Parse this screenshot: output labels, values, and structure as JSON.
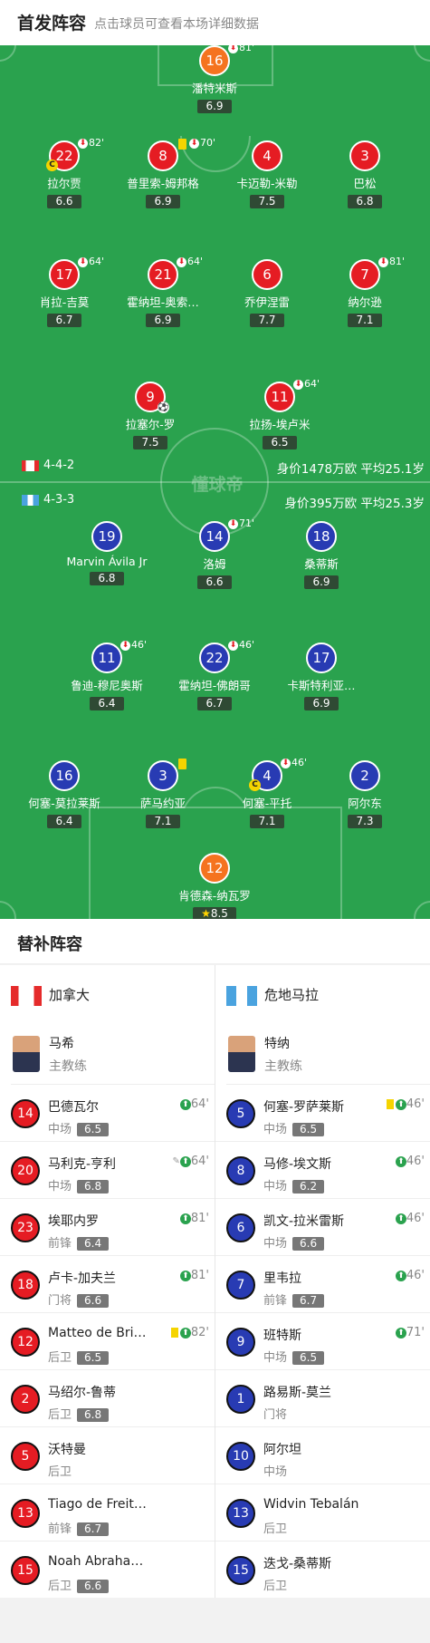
{
  "header": {
    "title": "首发阵容",
    "subtitle": "点击球员可查看本场详细数据"
  },
  "watermark": "懂球帝",
  "home": {
    "formation": "4-4-2",
    "info": "身价1478万欧  平均25.1岁",
    "players": [
      {
        "num": "16",
        "name": "潘特米斯",
        "rating": "6.9",
        "sub": "81'"
      },
      {
        "num": "22",
        "name": "拉尔贾",
        "rating": "6.6",
        "sub": "82'",
        "captain": "C"
      },
      {
        "num": "8",
        "name": "普里索-姆邦格",
        "rating": "6.9",
        "sub": "70'",
        "yellow": true
      },
      {
        "num": "4",
        "name": "卡迈勒-米勒",
        "rating": "7.5"
      },
      {
        "num": "3",
        "name": "巴松",
        "rating": "6.8"
      },
      {
        "num": "17",
        "name": "肖拉-吉莫",
        "rating": "6.7",
        "sub": "64'"
      },
      {
        "num": "21",
        "name": "霍纳坦-奥索…",
        "rating": "6.9",
        "sub": "64'"
      },
      {
        "num": "6",
        "name": "乔伊涅雷",
        "rating": "7.7"
      },
      {
        "num": "7",
        "name": "纳尔逊",
        "rating": "7.1",
        "sub": "81'"
      },
      {
        "num": "9",
        "name": "拉塞尔-罗",
        "rating": "7.5",
        "goal": true
      },
      {
        "num": "11",
        "name": "拉扬-埃卢米",
        "rating": "6.5",
        "sub": "64'"
      }
    ]
  },
  "away": {
    "formation": "4-3-3",
    "info": "身价395万欧    平均25.3岁",
    "players": [
      {
        "num": "19",
        "name": "Marvin Ávila Jr",
        "rating": "6.8"
      },
      {
        "num": "14",
        "name": "洛姆",
        "rating": "6.6",
        "sub": "71'"
      },
      {
        "num": "18",
        "name": "桑蒂斯",
        "rating": "6.9"
      },
      {
        "num": "11",
        "name": "鲁迪-穆尼奥斯",
        "rating": "6.4",
        "sub": "46'"
      },
      {
        "num": "22",
        "name": "霍纳坦-佛朗哥",
        "rating": "6.7",
        "sub": "46'"
      },
      {
        "num": "17",
        "name": "卡斯特利亚…",
        "rating": "6.9"
      },
      {
        "num": "16",
        "name": "何塞-莫拉莱斯",
        "rating": "6.4"
      },
      {
        "num": "3",
        "name": "萨马约亚",
        "rating": "7.1",
        "yellow": true
      },
      {
        "num": "4",
        "name": "何塞-平托",
        "rating": "7.1",
        "sub": "46'",
        "captain": "C"
      },
      {
        "num": "2",
        "name": "阿尔东",
        "rating": "7.3"
      },
      {
        "num": "12",
        "name": "肯德森-纳瓦罗",
        "rating": "8.5",
        "star": true
      }
    ]
  },
  "subs": {
    "title": "替补阵容",
    "home": {
      "team": "加拿大",
      "coach": {
        "name": "马希",
        "role": "主教练"
      },
      "players": [
        {
          "num": "14",
          "name": "巴德瓦尔",
          "pos": "中场",
          "rating": "6.5",
          "time": "64'"
        },
        {
          "num": "20",
          "name": "马利克-亨利",
          "pos": "中场",
          "rating": "6.8",
          "time": "64'",
          "whistle": true
        },
        {
          "num": "23",
          "name": "埃耶内罗",
          "pos": "前锋",
          "rating": "6.4",
          "time": "81'"
        },
        {
          "num": "18",
          "name": "卢卡-加夫兰",
          "pos": "门将",
          "rating": "6.6",
          "time": "81'"
        },
        {
          "num": "12",
          "name": "Matteo de Bri…",
          "pos": "后卫",
          "rating": "6.5",
          "time": "82'",
          "yellow": true
        },
        {
          "num": "2",
          "name": "马绍尔-鲁蒂",
          "pos": "后卫",
          "rating": "6.8"
        },
        {
          "num": "5",
          "name": "沃特曼",
          "pos": "后卫"
        },
        {
          "num": "13",
          "name": "Tiago de Freit…",
          "pos": "前锋",
          "rating": "6.7"
        },
        {
          "num": "15",
          "name": "Noah Abraha…",
          "pos": "后卫",
          "rating": "6.6"
        }
      ]
    },
    "away": {
      "team": "危地马拉",
      "coach": {
        "name": "特纳",
        "role": "主教练"
      },
      "players": [
        {
          "num": "5",
          "name": "何塞-罗萨莱斯",
          "pos": "中场",
          "rating": "6.5",
          "time": "46'",
          "yellow": true
        },
        {
          "num": "8",
          "name": "马修-埃文斯",
          "pos": "中场",
          "rating": "6.2",
          "time": "46'"
        },
        {
          "num": "6",
          "name": "凯文-拉米雷斯",
          "pos": "中场",
          "rating": "6.6",
          "time": "46'"
        },
        {
          "num": "7",
          "name": "里韦拉",
          "pos": "前锋",
          "rating": "6.7",
          "time": "46'"
        },
        {
          "num": "9",
          "name": "班特斯",
          "pos": "中场",
          "rating": "6.5",
          "time": "71'"
        },
        {
          "num": "1",
          "name": "路易斯-莫兰",
          "pos": "门将"
        },
        {
          "num": "10",
          "name": "阿尔坦",
          "pos": "中场"
        },
        {
          "num": "13",
          "name": "Widvin Tebalán",
          "pos": "后卫"
        },
        {
          "num": "15",
          "name": "迭戈-桑蒂斯",
          "pos": "后卫"
        }
      ]
    }
  }
}
